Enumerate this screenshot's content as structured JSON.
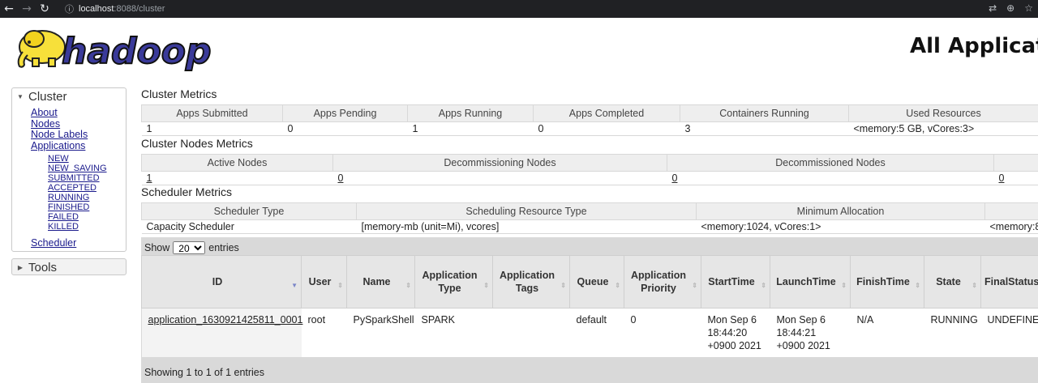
{
  "browser": {
    "host": "localhost",
    "path": ":8088/cluster"
  },
  "header": {
    "logo_text": "hadoop",
    "title": "All Applicat"
  },
  "sidebar": {
    "cluster_label": "Cluster",
    "links": [
      "About",
      "Nodes",
      "Node Labels",
      "Applications"
    ],
    "app_states": [
      "NEW",
      "NEW_SAVING",
      "SUBMITTED",
      "ACCEPTED",
      "RUNNING",
      "FINISHED",
      "FAILED",
      "KILLED"
    ],
    "scheduler_label": "Scheduler",
    "tools_label": "Tools"
  },
  "cluster_metrics": {
    "title": "Cluster Metrics",
    "headers": [
      "Apps Submitted",
      "Apps Pending",
      "Apps Running",
      "Apps Completed",
      "Containers Running",
      "Used Resources"
    ],
    "values": [
      "1",
      "0",
      "1",
      "0",
      "3",
      "<memory:5 GB, vCores:3>"
    ]
  },
  "nodes_metrics": {
    "title": "Cluster Nodes Metrics",
    "headers": [
      "Active Nodes",
      "Decommissioning Nodes",
      "Decommissioned Nodes",
      ""
    ],
    "values": [
      "1",
      "0",
      "0",
      "0"
    ]
  },
  "scheduler_metrics": {
    "title": "Scheduler Metrics",
    "headers": [
      "Scheduler Type",
      "Scheduling Resource Type",
      "Minimum Allocation",
      ""
    ],
    "values": [
      "Capacity Scheduler",
      "[memory-mb (unit=Mi), vcores]",
      "<memory:1024, vCores:1>",
      "<memory:8"
    ]
  },
  "applications": {
    "show_label": "Show",
    "page_size": "20",
    "entries_label": "entries",
    "columns": [
      "ID",
      "User",
      "Name",
      "Application Type",
      "Application Tags",
      "Queue",
      "Application Priority",
      "StartTime",
      "LaunchTime",
      "FinishTime",
      "State",
      "FinalStatus"
    ],
    "rows": [
      {
        "id": "application_1630921425811_0001",
        "user": "root",
        "name": "PySparkShell",
        "type": "SPARK",
        "tags": "",
        "queue": "default",
        "priority": "0",
        "start_l1": "Mon Sep 6",
        "start_l2": "18:44:20",
        "start_l3": "+0900 2021",
        "launch_l1": "Mon Sep 6",
        "launch_l2": "18:44:21",
        "launch_l3": "+0900 2021",
        "finish": "N/A",
        "state": "RUNNING",
        "final_status": "UNDEFINED"
      }
    ],
    "footer": "Showing 1 to 1 of 1 entries"
  }
}
